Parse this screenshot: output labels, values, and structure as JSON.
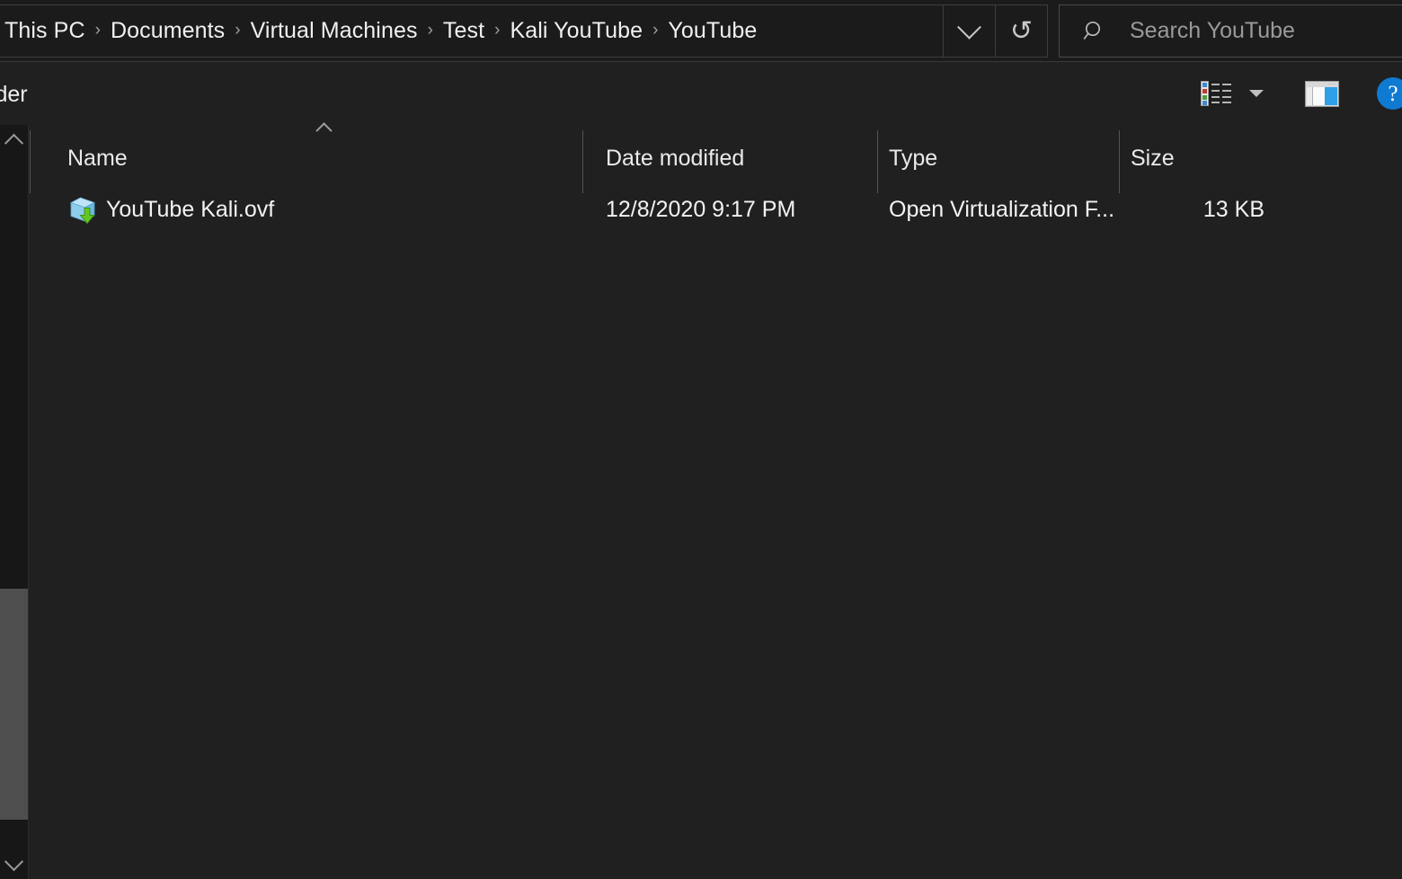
{
  "window": {
    "app": "File Explorer",
    "theme_background": "#202020",
    "accent": "#0f7ad2"
  },
  "address_bar": {
    "breadcrumb": [
      "This PC",
      "Documents",
      "Virtual Machines",
      "Test",
      "Kali YouTube",
      "YouTube"
    ],
    "separator": "›",
    "history_dropdown_icon": "chevron-down-icon",
    "refresh_icon": "refresh-icon",
    "refresh_glyph": "↻"
  },
  "search": {
    "icon": "search-icon",
    "placeholder": "Search YouTube",
    "value": ""
  },
  "toolbar": {
    "new_folder_label": "older",
    "view_layout_icon": "details-view-icon",
    "view_dropdown_icon": "chevron-down-icon",
    "preview_pane_icon": "preview-pane-icon",
    "help_label": "?",
    "help_icon": "help-icon"
  },
  "scrollbar": {
    "up_icon": "chevron-up-icon",
    "down_icon": "chevron-down-icon",
    "orientation": "vertical"
  },
  "file_list": {
    "sort_column": "Name",
    "sort_direction": "ascending",
    "sort_icon": "chevron-up-icon",
    "columns": [
      "Name",
      "Date modified",
      "Type",
      "Size"
    ],
    "rows": [
      {
        "icon": "ovf-appliance-icon",
        "name": "YouTube Kali.ovf",
        "date_modified": "12/8/2020 9:17 PM",
        "type": "Open Virtualization F...",
        "size": "13 KB"
      }
    ]
  }
}
